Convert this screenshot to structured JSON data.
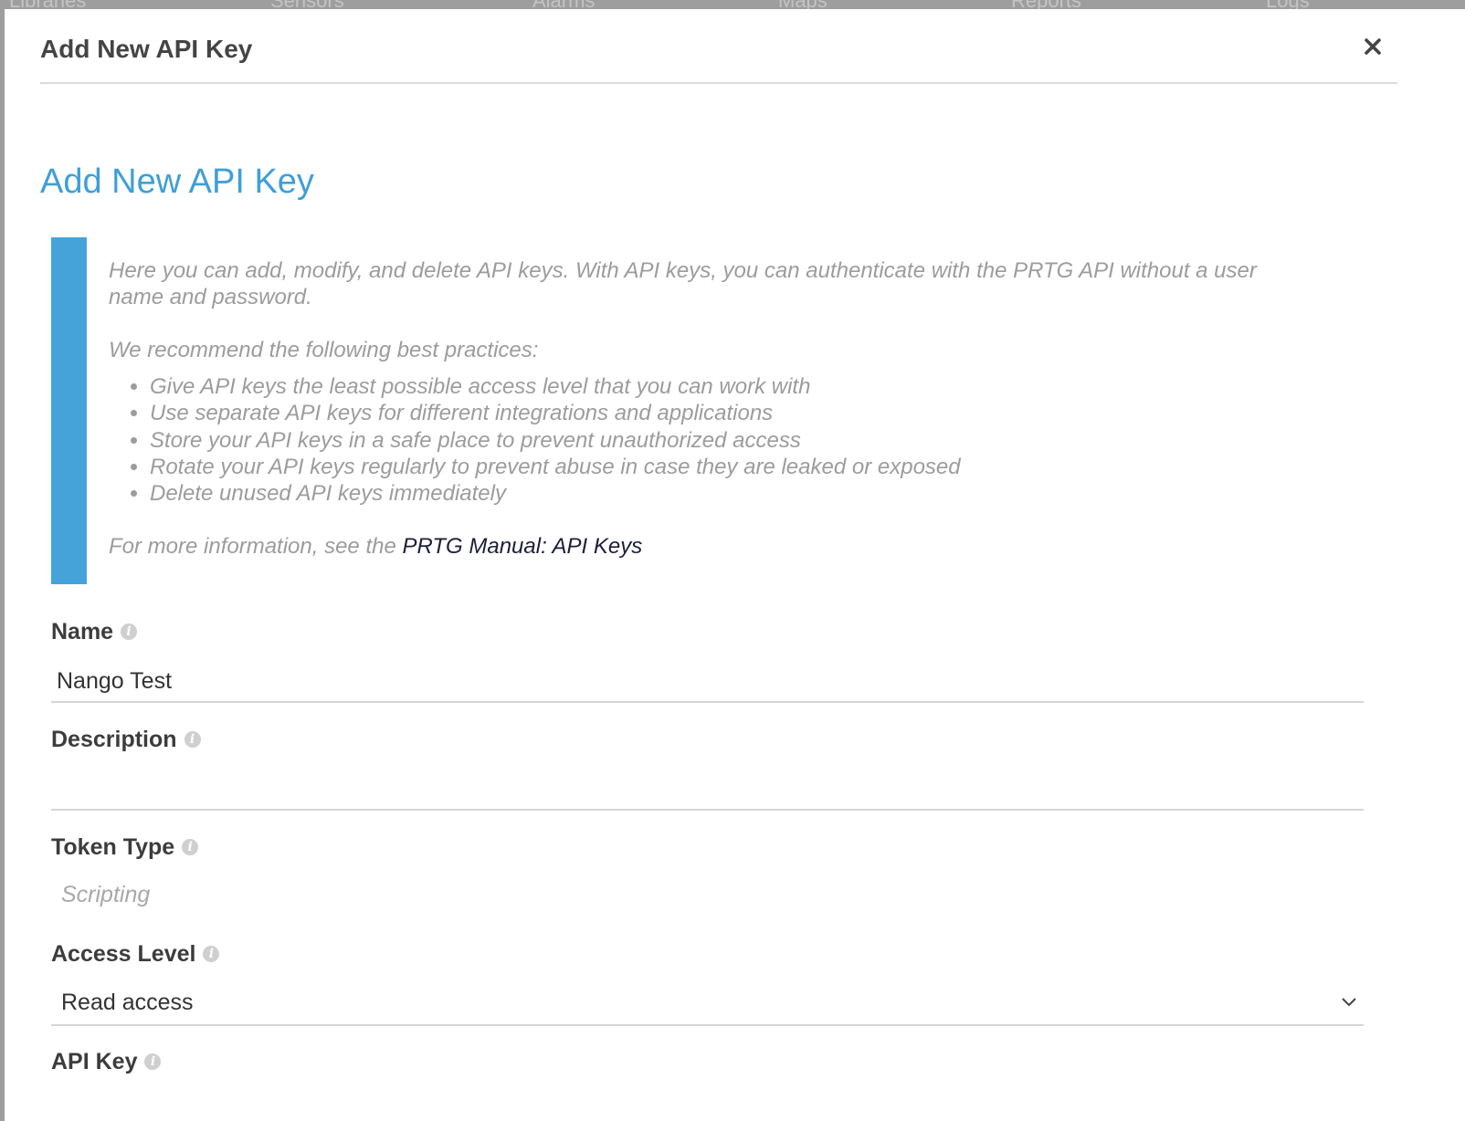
{
  "background_nav": [
    "Libraries",
    "Sensors",
    "Alarms",
    "Maps",
    "Reports",
    "Logs"
  ],
  "dialog": {
    "title": "Add New API Key",
    "close_icon": "close-icon"
  },
  "heading": "Add New API Key",
  "info": {
    "intro": "Here you can add, modify, and delete API keys. With API keys, you can authenticate with the PRTG API without a user name and password.",
    "recommend": "We recommend the following best practices:",
    "practices": [
      "Give API keys the least possible access level that you can work with",
      "Use separate API keys for different integrations and applications",
      "Store your API keys in a safe place to prevent unauthorized access",
      "Rotate your API keys regularly to prevent abuse in case they are leaked or exposed",
      "Delete unused API keys immediately"
    ],
    "more_prefix": "For more information, see the ",
    "more_link": "PRTG Manual: API Keys"
  },
  "form": {
    "name_label": "Name",
    "name_value": "Nango Test",
    "description_label": "Description",
    "description_value": "",
    "token_type_label": "Token Type",
    "token_type_value": "Scripting",
    "access_level_label": "Access Level",
    "access_level_value": "Read access",
    "api_key_label": "API Key"
  },
  "colors": {
    "accent": "#46a3da",
    "heading": "#3f9fd8"
  }
}
